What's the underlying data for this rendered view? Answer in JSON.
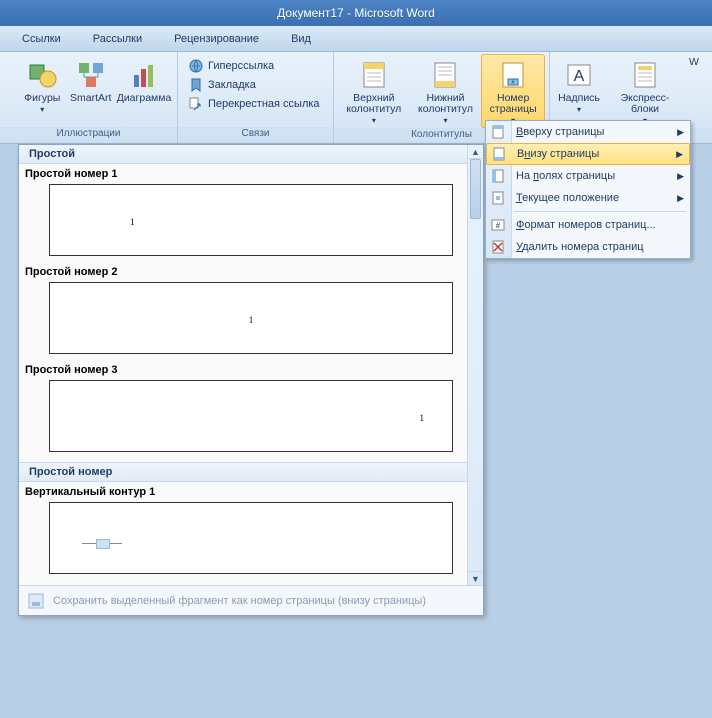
{
  "title": "Документ17 - Microsoft Word",
  "tabs": [
    "Ссылки",
    "Рассылки",
    "Рецензирование",
    "Вид"
  ],
  "ribbon": {
    "illus": {
      "label": "Иллюстрации",
      "items": [
        "",
        "Фигуры",
        "SmartArt",
        "Диаграмма"
      ]
    },
    "links": {
      "label": "Связи",
      "items": [
        "Гиперссылка",
        "Закладка",
        "Перекрестная ссылка"
      ]
    },
    "hf": {
      "label": "Колонтитулы",
      "header": "Верхний колонтитул",
      "footer": "Нижний колонтитул",
      "pagenum": "Номер страницы"
    },
    "text": {
      "textbox": "Надпись",
      "quick": "Экспресс-блоки",
      "w": "W"
    }
  },
  "submenu": {
    "top": "Вверху страницы",
    "bottom": "Внизу страницы",
    "margins": "На полях страницы",
    "current": "Текущее положение",
    "format": "Формат номеров страниц...",
    "remove": "Удалить номера страниц"
  },
  "gallery": {
    "cat1": "Простой",
    "item1": "Простой номер 1",
    "item2": "Простой номер 2",
    "item3": "Простой номер 3",
    "cat2": "Простой номер",
    "item4": "Вертикальный контур 1",
    "sample": "1",
    "save": "Сохранить выделенный фрагмент как номер страницы (внизу страницы)"
  }
}
